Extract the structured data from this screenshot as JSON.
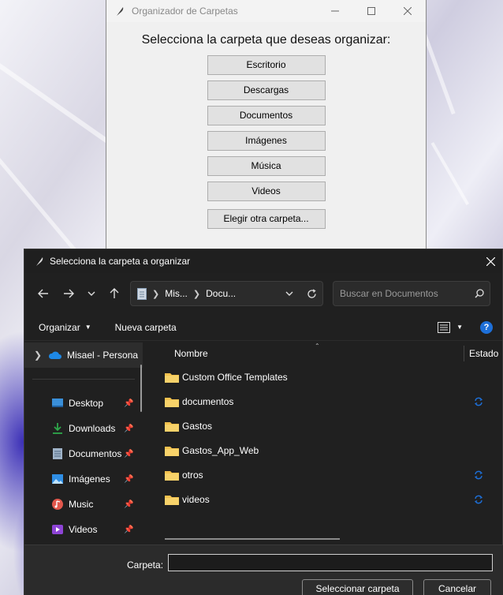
{
  "tk_window": {
    "title": "Organizador de Carpetas",
    "heading": "Selecciona la carpeta que deseas organizar:",
    "buttons": [
      "Escritorio",
      "Descargas",
      "Documentos",
      "Imágenes",
      "Música",
      "Videos"
    ],
    "other_button": "Elegir otra carpeta..."
  },
  "dialog": {
    "title": "Selecciona la carpeta a organizar",
    "address": {
      "crumbs": [
        "Mis...",
        "Docu..."
      ]
    },
    "search": {
      "placeholder": "Buscar en Documentos"
    },
    "commands": {
      "organize": "Organizar",
      "new_folder": "Nueva carpeta"
    },
    "nav_pane": {
      "onedrive": "Misael - Persona",
      "quick_access": [
        {
          "label": "Desktop",
          "icon": "desktop-icon"
        },
        {
          "label": "Downloads",
          "icon": "download-icon"
        },
        {
          "label": "Documentos",
          "icon": "document-icon"
        },
        {
          "label": "Imágenes",
          "icon": "image-icon"
        },
        {
          "label": "Music",
          "icon": "music-icon"
        },
        {
          "label": "Videos",
          "icon": "video-icon"
        }
      ]
    },
    "columns": {
      "name": "Nombre",
      "status": "Estado"
    },
    "files": [
      {
        "name": "Custom Office Templates",
        "synced": false
      },
      {
        "name": "documentos",
        "synced": true
      },
      {
        "name": "Gastos",
        "synced": false
      },
      {
        "name": "Gastos_App_Web",
        "synced": false
      },
      {
        "name": "otros",
        "synced": true
      },
      {
        "name": "videos",
        "synced": true
      }
    ],
    "footer": {
      "folder_label": "Carpeta:",
      "folder_value": "",
      "select_button": "Seleccionar carpeta",
      "cancel_button": "Cancelar"
    }
  },
  "colors": {
    "accent": "#1d6fd8",
    "folder": "#f2c14e",
    "dialog_bg": "#202020"
  }
}
